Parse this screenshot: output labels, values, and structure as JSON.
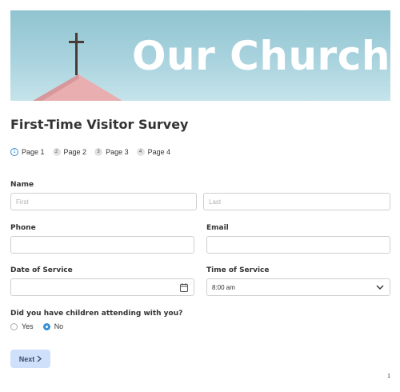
{
  "banner": {
    "title": "Our Church"
  },
  "survey": {
    "title": "First-Time Visitor Survey"
  },
  "steps": [
    {
      "num": "1",
      "label": "Page 1"
    },
    {
      "num": "2",
      "label": "Page 2"
    },
    {
      "num": "3",
      "label": "Page 3"
    },
    {
      "num": "4",
      "label": "Page 4"
    }
  ],
  "fields": {
    "name_label": "Name",
    "first_placeholder": "First",
    "last_placeholder": "Last",
    "phone_label": "Phone",
    "email_label": "Email",
    "date_label": "Date of Service",
    "time_label": "Time of Service",
    "time_value": "8:00 am",
    "children_label": "Did you have children attending with you?",
    "children_options": [
      "Yes",
      "No"
    ],
    "children_selected": "No"
  },
  "buttons": {
    "next_label": "Next"
  },
  "footer": {
    "page_number": "1"
  },
  "colors": {
    "accent": "#3a8fd3",
    "banner": "#a9d3de",
    "next_button": "#cfe0fb"
  },
  "icons": {
    "date": "calendar-icon",
    "time": "chevron-down-icon",
    "next": "chevron-right-icon"
  }
}
